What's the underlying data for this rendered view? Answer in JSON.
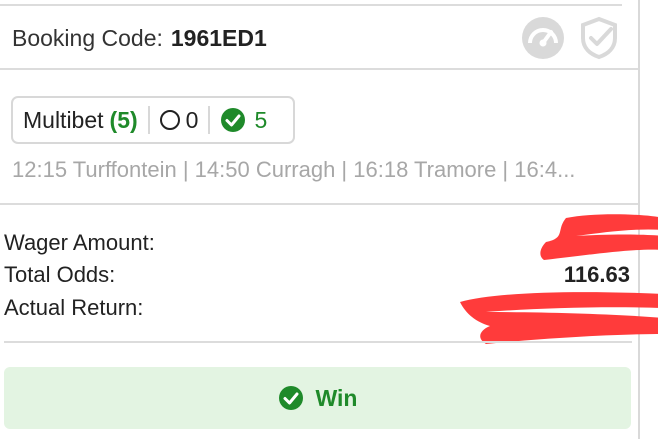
{
  "booking": {
    "label": "Booking Code:",
    "code": "1961ED1"
  },
  "icons": {
    "gauge": "gauge-icon",
    "shield": "shield-check-icon"
  },
  "multibet": {
    "label": "Multibet",
    "count": "(5)",
    "lost": "0",
    "won": "5"
  },
  "races": "12:15 Turffontein | 14:50 Curragh | 16:18 Tramore | 16:4...",
  "summary": {
    "wager_label": "Wager Amount:",
    "odds_label": "Total Odds:",
    "odds_value": "116.63",
    "return_label": "Actual Return:"
  },
  "result": {
    "label": "Win"
  },
  "colors": {
    "win_green": "#1f8a2a",
    "win_bg": "#e3f4e2",
    "redaction": "#ff3b3b"
  }
}
